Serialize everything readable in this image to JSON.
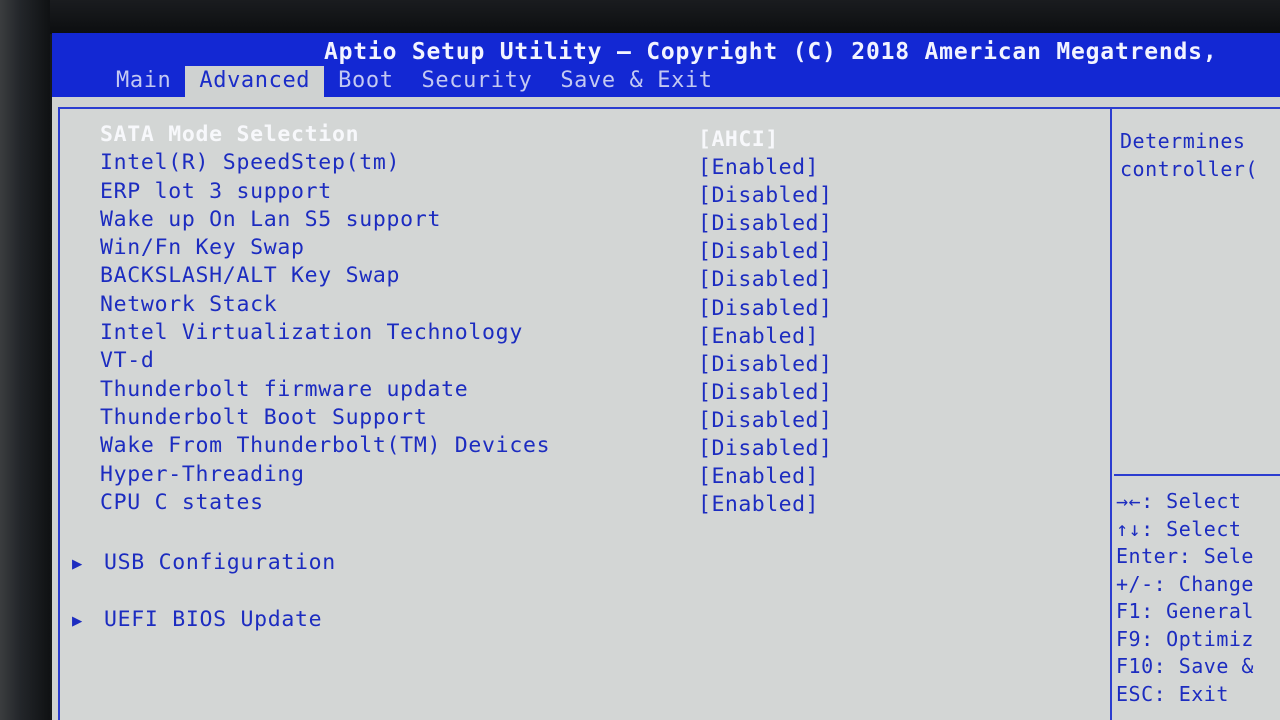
{
  "header": {
    "title": "Aptio Setup Utility – Copyright (C) 2018 American Megatrends,"
  },
  "tabs": [
    {
      "label": "Main"
    },
    {
      "label": "Advanced"
    },
    {
      "label": "Boot"
    },
    {
      "label": "Security"
    },
    {
      "label": "Save & Exit"
    }
  ],
  "active_tab": "Advanced",
  "settings": [
    {
      "label": "SATA Mode Selection",
      "value": "[AHCI]"
    },
    {
      "label": "Intel(R) SpeedStep(tm)",
      "value": "[Enabled]"
    },
    {
      "label": "ERP lot 3 support",
      "value": "[Disabled]"
    },
    {
      "label": "Wake up On Lan S5 support",
      "value": "[Disabled]"
    },
    {
      "label": "Win/Fn Key Swap",
      "value": "[Disabled]"
    },
    {
      "label": "BACKSLASH/ALT Key Swap",
      "value": "[Disabled]"
    },
    {
      "label": "Network Stack",
      "value": "[Disabled]"
    },
    {
      "label": "Intel Virtualization Technology",
      "value": "[Enabled]"
    },
    {
      "label": "VT-d",
      "value": "[Disabled]"
    },
    {
      "label": "Thunderbolt firmware update",
      "value": "[Disabled]"
    },
    {
      "label": "Thunderbolt Boot Support",
      "value": "[Disabled]"
    },
    {
      "label": "Wake From Thunderbolt(TM) Devices",
      "value": "[Disabled]"
    },
    {
      "label": "Hyper-Threading",
      "value": "[Enabled]"
    },
    {
      "label": "CPU C states",
      "value": "[Enabled]"
    }
  ],
  "submenus": [
    {
      "label": "USB Configuration",
      "icon": "triangle-right-icon"
    },
    {
      "label": "UEFI BIOS Update",
      "icon": "triangle-right-icon"
    }
  ],
  "help": {
    "line1": "Determines",
    "line2": "controller("
  },
  "key_help": [
    "→←: Select",
    "↑↓: Select",
    "Enter: Sele",
    "+/-: Change",
    "F1: General",
    "F9: Optimiz",
    "F10: Save &",
    "ESC: Exit"
  ],
  "colors": {
    "header_bg": "#1328d3",
    "body_bg": "#cfd2d1",
    "text": "#1c2cc0",
    "selected_text": "#f7f8fb"
  }
}
